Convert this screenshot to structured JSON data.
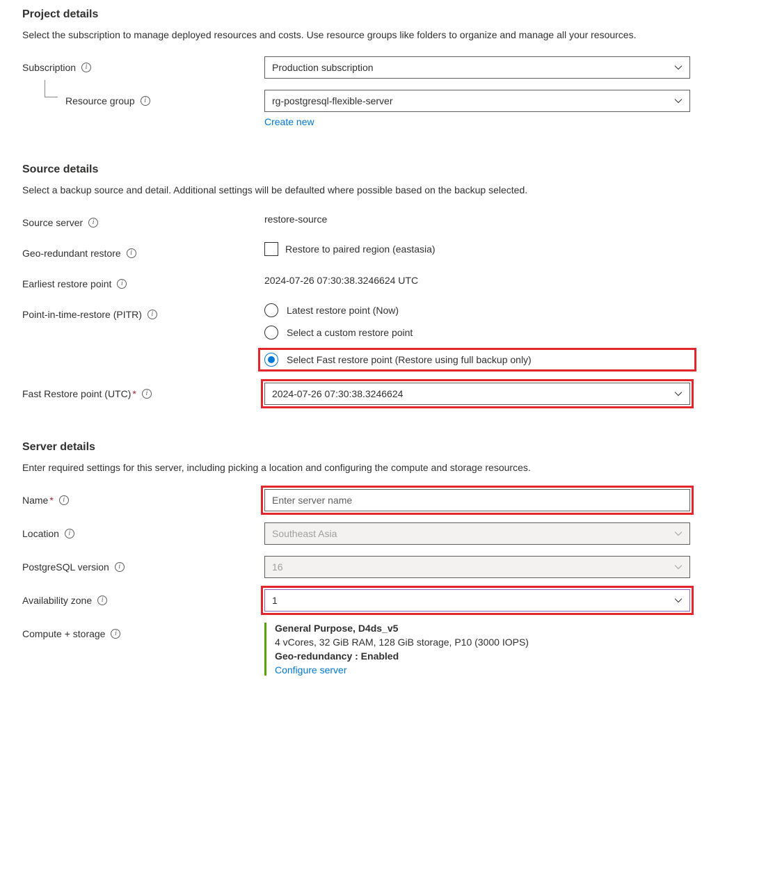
{
  "project": {
    "heading": "Project details",
    "desc": "Select the subscription to manage deployed resources and costs. Use resource groups like folders to organize and manage all your resources.",
    "subscription_label": "Subscription",
    "subscription_value": "Production subscription",
    "resource_group_label": "Resource group",
    "resource_group_value": "rg-postgresql-flexible-server",
    "create_new": "Create new"
  },
  "source": {
    "heading": "Source details",
    "desc": "Select a backup source and detail. Additional settings will be defaulted where possible based on the backup selected.",
    "source_server_label": "Source server",
    "source_server_value": "restore-source",
    "geo_label": "Geo-redundant restore",
    "geo_checkbox_label": "Restore to paired region (eastasia)",
    "earliest_label": "Earliest restore point",
    "earliest_value": "2024-07-26 07:30:38.3246624 UTC",
    "pitr_label": "Point-in-time-restore (PITR)",
    "pitr_options": {
      "latest": "Latest restore point (Now)",
      "custom": "Select a custom restore point",
      "fast": "Select Fast restore point (Restore using full backup only)"
    },
    "fast_point_label": "Fast Restore point (UTC)",
    "fast_point_value": "2024-07-26 07:30:38.3246624"
  },
  "server": {
    "heading": "Server details",
    "desc": "Enter required settings for this server, including picking a location and configuring the compute and storage resources.",
    "name_label": "Name",
    "name_placeholder": "Enter server name",
    "location_label": "Location",
    "location_value": "Southeast Asia",
    "pg_version_label": "PostgreSQL version",
    "pg_version_value": "16",
    "az_label": "Availability zone",
    "az_value": "1",
    "compute_label": "Compute + storage",
    "compute": {
      "title": "General Purpose, D4ds_v5",
      "spec": "4 vCores, 32 GiB RAM, 128 GiB storage, P10 (3000 IOPS)",
      "geo": "Geo-redundancy : Enabled",
      "configure": "Configure server"
    }
  }
}
